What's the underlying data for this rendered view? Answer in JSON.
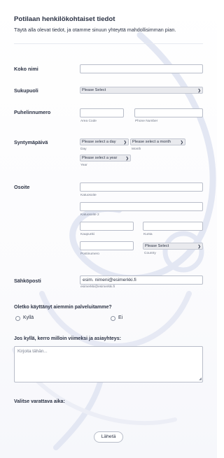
{
  "form": {
    "title": "Potilaan henkilökohtaiset tiedot",
    "subtitle": "Täytä alla olevat tiedot, ja otamme sinuun yhteyttä mahdollisimman pian."
  },
  "fields": {
    "full_name": {
      "label": "Koko nimi",
      "value": ""
    },
    "gender": {
      "label": "Sukupuoli",
      "selected": "Please Select"
    },
    "phone": {
      "label": "Puhelinnumero",
      "area_code_label": "Area Code",
      "phone_number_label": "Phone Number"
    },
    "birthdate": {
      "label": "Syntymäpäivä",
      "day_selected": "Please select a day",
      "day_label": "Day",
      "month_selected": "Please select a month",
      "month_label": "Month",
      "year_selected": "Please select a year",
      "year_label": "Year"
    },
    "address": {
      "label": "Osoite",
      "street1_label": "Katuosoite",
      "street2_label": "Katuosoite 2",
      "city_label": "Kaupunki",
      "municipality_label": "Kunta",
      "postal_label": "Postinumero",
      "country_selected": "Please Select",
      "country_label": "Country"
    },
    "email": {
      "label": "Sähköposti",
      "value": "esim. nimeni@esimerkki.fi",
      "hint": "esimerkki@esimerkki.fi"
    }
  },
  "previous_use": {
    "question": "Oletko käyttänyt aiemmin palveluitamme?",
    "options": [
      "Kyllä",
      "Ei"
    ]
  },
  "details": {
    "question": "Jos kyllä, kerro milloin viimeksi ja asiayhteys:",
    "placeholder": "Kirjoita tähän..."
  },
  "appointment": {
    "label": "Valitse varattava aika:"
  },
  "submit_label": "Lähetä",
  "colors": {
    "accent_shape": "#dfe3f2",
    "border": "#b8bdc9",
    "text": "#2c3345"
  }
}
